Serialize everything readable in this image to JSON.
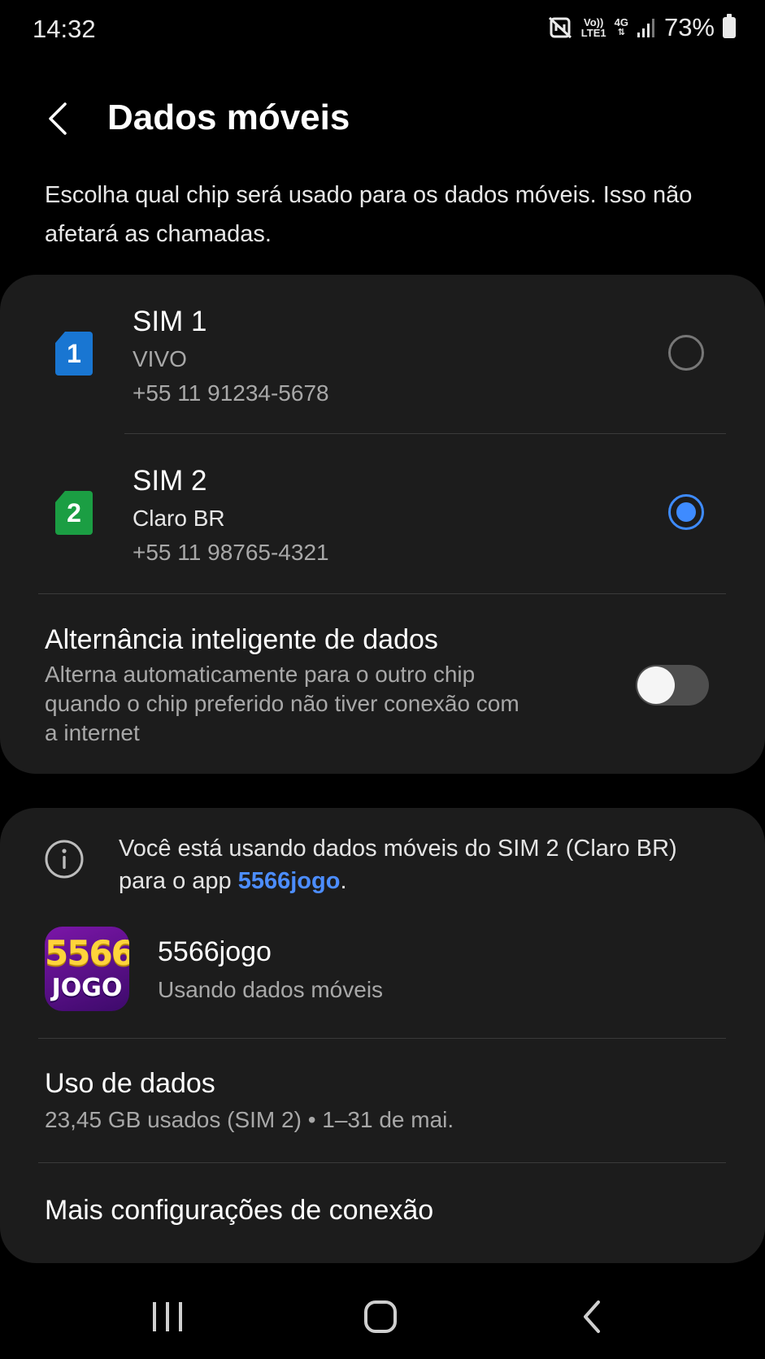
{
  "status_bar": {
    "time": "14:32",
    "volte_top": "Vo))",
    "volte_bottom": "LTE1",
    "network_type": "4G",
    "battery_percent": "73%",
    "icons": [
      "nfc-icon",
      "volte-icon",
      "4g-data-icon",
      "signal-icon",
      "battery-icon"
    ]
  },
  "header": {
    "title": "Dados móveis",
    "back_icon": "chevron-left-icon"
  },
  "description": "Escolha qual chip será usado para os dados móveis. Isso não afetará as chamadas.",
  "sims": [
    {
      "badge": "1",
      "name": "SIM 1",
      "carrier": "VIVO",
      "number": "+55 11 91234-5678",
      "selected": false,
      "badge_color": "#1976d2",
      "carrier_color": "#a8a8a8"
    },
    {
      "badge": "2",
      "name": "SIM 2",
      "carrier": "Claro BR",
      "number": "+55 11 98765-4321",
      "selected": true,
      "badge_color": "#1b9e43",
      "carrier_color": "#e6e6e6"
    }
  ],
  "smart_switch": {
    "title": "Alternância inteligente de dados",
    "description": "Alterna automaticamente para o outro chip quando o chip preferido não tiver conexão com a internet",
    "enabled": false
  },
  "info": {
    "icon": "info-icon",
    "text_before": "Você está usando dados móveis do SIM 2 (Claro BR) para o app ",
    "link": "5566jogo",
    "text_after": "."
  },
  "app": {
    "logo_top": "5566",
    "logo_bottom": "JOGO",
    "name": "5566jogo",
    "status": "Usando dados móveis"
  },
  "data_usage": {
    "title": "Uso de dados",
    "subtitle": "23,45 GB usados (SIM 2) • 1–31 de mai."
  },
  "more_settings": {
    "label": "Mais configurações de conexão"
  },
  "nav": {
    "items": [
      "recent-apps-icon",
      "home-icon",
      "back-icon"
    ]
  },
  "colors": {
    "accent": "#3e8bff",
    "link": "#4c8dff",
    "card_background": "#1c1c1c",
    "background": "#000000"
  }
}
